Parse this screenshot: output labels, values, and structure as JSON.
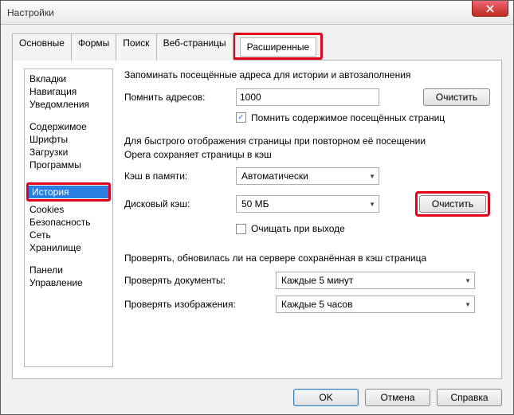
{
  "window": {
    "title": "Настройки"
  },
  "tabs": {
    "0": "Основные",
    "1": "Формы",
    "2": "Поиск",
    "3": "Веб-страницы",
    "4": "Расширенные"
  },
  "sidebar": {
    "0": "Вкладки",
    "1": "Навигация",
    "2": "Уведомления",
    "3": "Содержимое",
    "4": "Шрифты",
    "5": "Загрузки",
    "6": "Программы",
    "7": "История",
    "8": "Cookies",
    "9": "Безопасность",
    "10": "Сеть",
    "11": "Хранилище",
    "12": "Панели",
    "13": "Управление"
  },
  "content": {
    "intro": "Запоминать посещённые адреса для истории и автозаполнения",
    "remember_label": "Помнить адресов:",
    "remember_value": "1000",
    "clear1": "Очистить",
    "remember_content": "Помнить содержимое посещённых страниц",
    "cache_intro1": "Для быстрого отображения страницы при повторном её посещении",
    "cache_intro2": "Opera сохраняет страницы в кэш",
    "mem_cache_label": "Кэш в памяти:",
    "mem_cache_value": "Автоматически",
    "disk_cache_label": "Дисковый кэш:",
    "disk_cache_value": "50 МБ",
    "clear2": "Очистить",
    "clear_on_exit": "Очищать при выходе",
    "check_intro": "Проверять, обновилась ли на сервере сохранённая в кэш страница",
    "check_docs_label": "Проверять документы:",
    "check_docs_value": "Каждые 5 минут",
    "check_imgs_label": "Проверять изображения:",
    "check_imgs_value": "Каждые 5 часов"
  },
  "footer": {
    "ok": "OK",
    "cancel": "Отмена",
    "help": "Справка"
  }
}
